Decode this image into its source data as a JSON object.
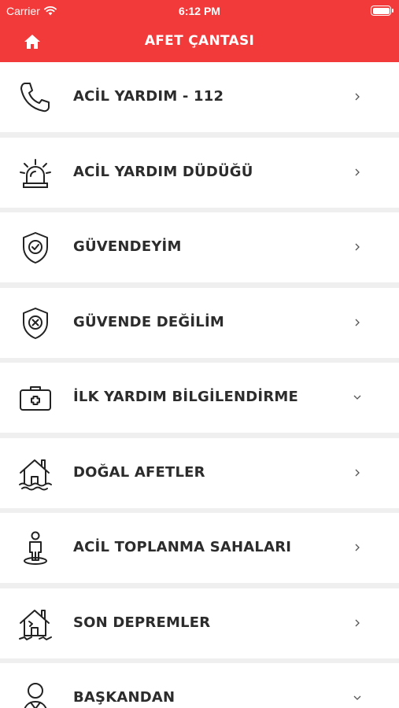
{
  "status_bar": {
    "carrier": "Carrier",
    "time": "6:12 PM"
  },
  "nav": {
    "title": "AFET ÇANTASI"
  },
  "menu": [
    {
      "label": "ACİL YARDIM - 112",
      "icon": "phone-icon",
      "chevron": "chevron-right-icon"
    },
    {
      "label": "ACİL YARDIM DÜDÜĞÜ",
      "icon": "siren-icon",
      "chevron": "chevron-right-icon"
    },
    {
      "label": "GÜVENDEYİM",
      "icon": "shield-check-icon",
      "chevron": "chevron-right-icon"
    },
    {
      "label": "GÜVENDE DEĞİLİM",
      "icon": "shield-x-icon",
      "chevron": "chevron-right-icon"
    },
    {
      "label": "İLK YARDIM BİLGİLENDİRME",
      "icon": "first-aid-kit-icon",
      "chevron": "chevron-down-icon"
    },
    {
      "label": "DOĞAL AFETLER",
      "icon": "flooded-house-icon",
      "chevron": "chevron-right-icon"
    },
    {
      "label": "ACİL TOPLANMA SAHALARI",
      "icon": "person-pin-icon",
      "chevron": "chevron-right-icon"
    },
    {
      "label": "SON DEPREMLER",
      "icon": "cracked-house-icon",
      "chevron": "chevron-right-icon"
    },
    {
      "label": "BAŞKANDAN",
      "icon": "person-icon",
      "chevron": "chevron-down-icon"
    }
  ]
}
